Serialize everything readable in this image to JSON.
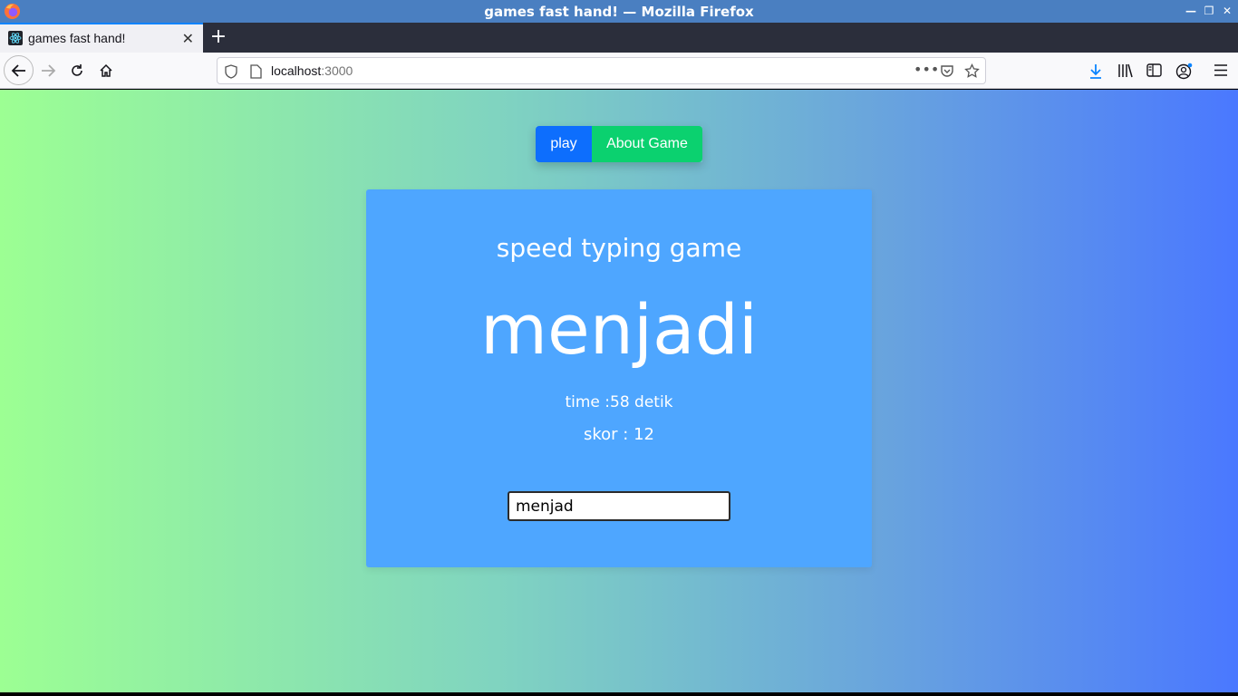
{
  "window": {
    "title": "games fast hand! — Mozilla Firefox"
  },
  "tabs": [
    {
      "label": "games fast hand!",
      "icon": "react-icon"
    }
  ],
  "address_bar": {
    "host": "localhost",
    "port": ":3000"
  },
  "app": {
    "nav": {
      "play_label": "play",
      "about_label": "About Game"
    },
    "title": "speed typing game",
    "current_word": "menjadi",
    "time_text": "time :58 detik",
    "score_text": "skor : 12",
    "input_value": "menjad"
  },
  "colors": {
    "play_button": "#0d6efd",
    "about_button": "#0bd16f",
    "card": "#4ea6ff",
    "gradient_left": "#9cff93",
    "gradient_right": "#4a78ff"
  }
}
